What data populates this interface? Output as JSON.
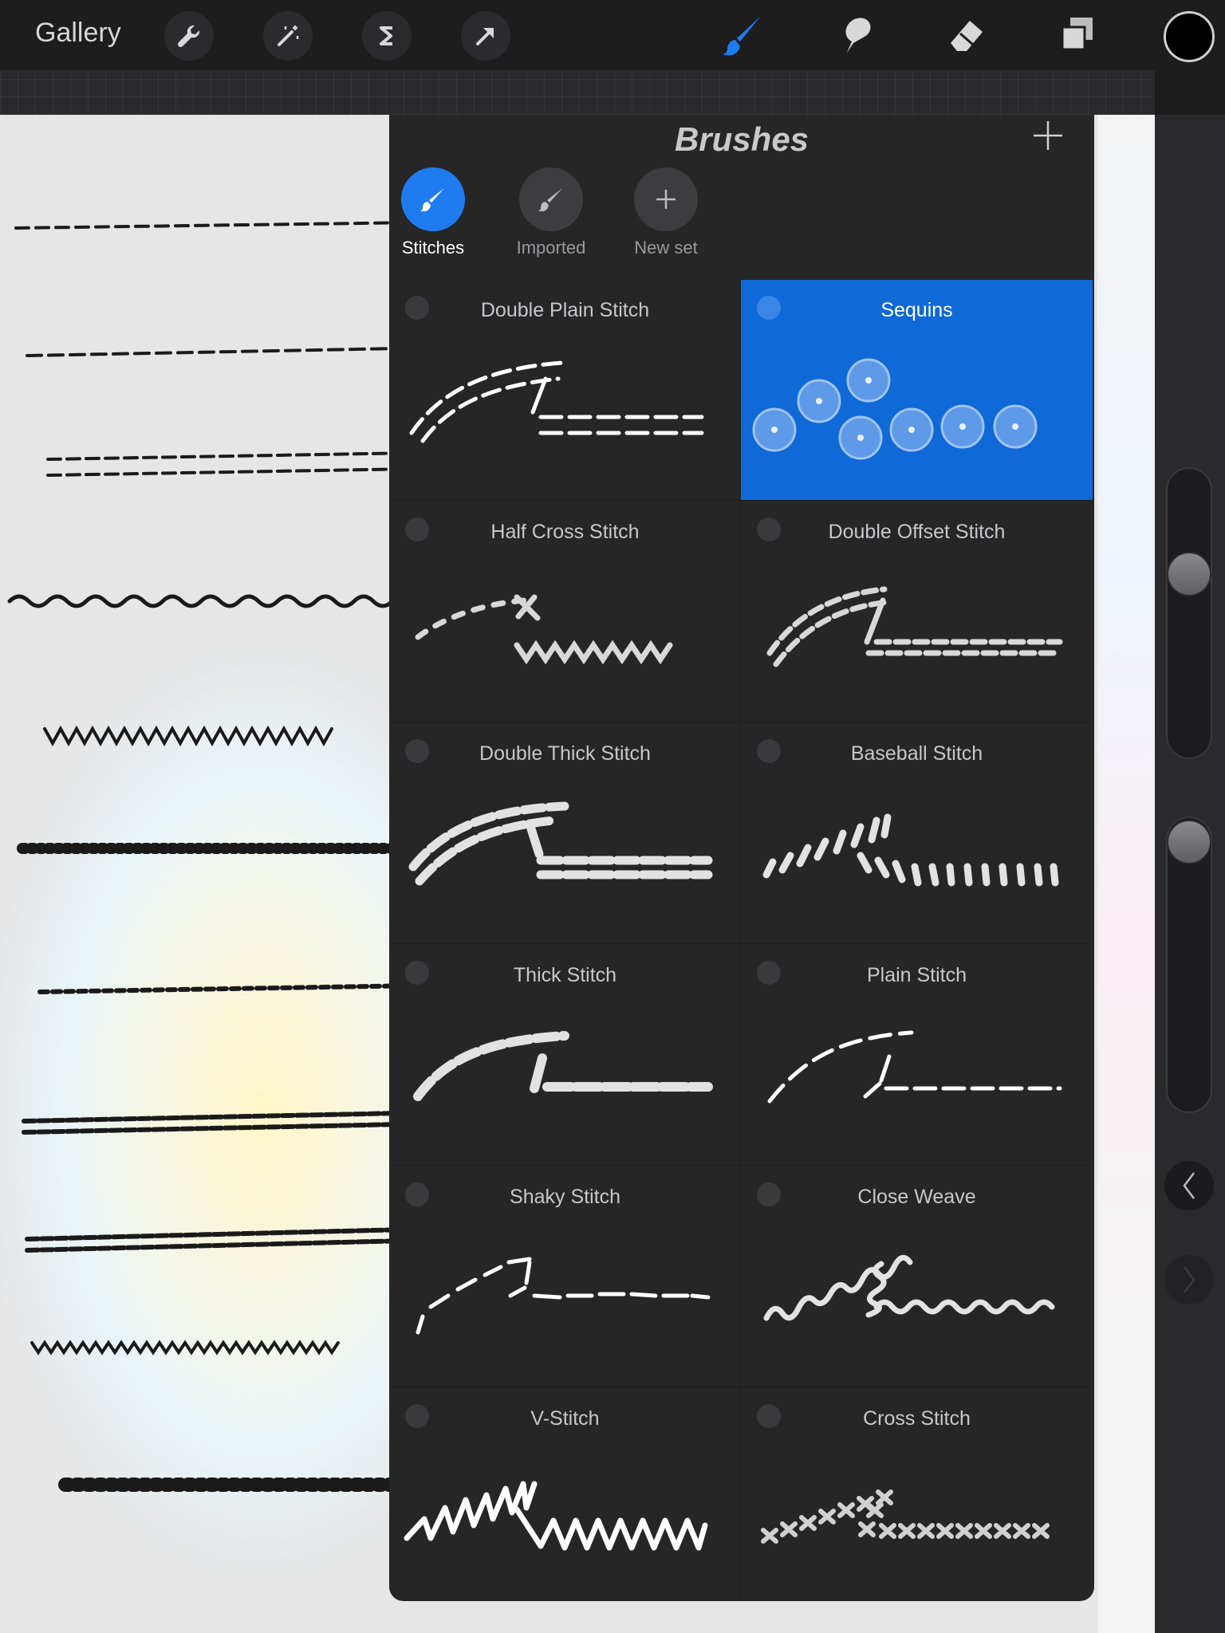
{
  "toolbar": {
    "gallery_label": "Gallery",
    "left_tools": [
      "wrench-icon",
      "magic-wand-icon",
      "selection-icon",
      "transform-arrow-icon"
    ],
    "right_tools": [
      "brush-icon",
      "smudge-icon",
      "eraser-icon",
      "layers-icon"
    ],
    "active_tool": "brush-icon",
    "accent_color": "#1f7cf0",
    "current_color": "#000000"
  },
  "brushes_panel": {
    "title": "Brushes",
    "sets": [
      {
        "label": "Stitches",
        "active": true
      },
      {
        "label": "Imported",
        "active": false
      },
      {
        "label": "New set",
        "active": false
      }
    ],
    "brushes": [
      {
        "name": "Double Plain Stitch",
        "selected": false
      },
      {
        "name": "Sequins",
        "selected": true
      },
      {
        "name": "Half Cross Stitch",
        "selected": false
      },
      {
        "name": "Double Offset Stitch",
        "selected": false
      },
      {
        "name": "Double Thick Stitch",
        "selected": false
      },
      {
        "name": "Baseball Stitch",
        "selected": false
      },
      {
        "name": "Thick Stitch",
        "selected": false
      },
      {
        "name": "Plain Stitch",
        "selected": false
      },
      {
        "name": "Shaky Stitch",
        "selected": false
      },
      {
        "name": "Close Weave",
        "selected": false
      },
      {
        "name": "V-Stitch",
        "selected": false
      },
      {
        "name": "Cross Stitch",
        "selected": false
      }
    ],
    "selected_color": "#0f69d6"
  },
  "sidebar": {
    "brush_size_level": 0.35,
    "opacity_level": 0.05,
    "undo_icon": "chevron-left-icon",
    "redo_icon": "chevron-right-icon"
  }
}
